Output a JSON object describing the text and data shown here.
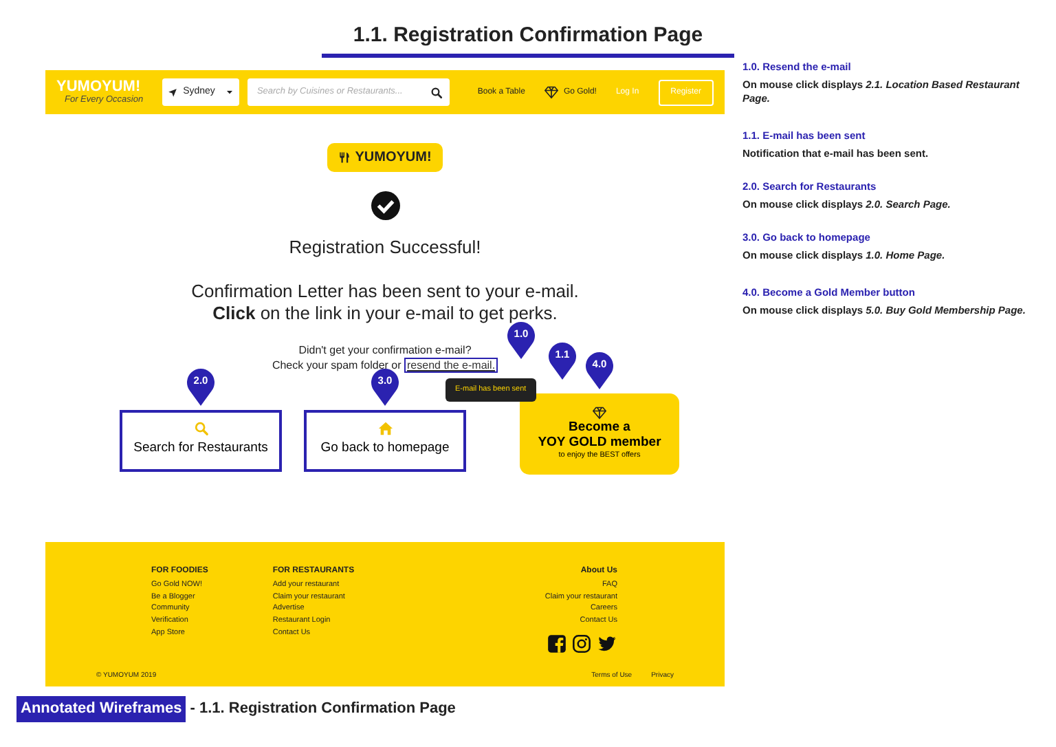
{
  "page_title": "1.1. Registration Confirmation Page",
  "header": {
    "logo": "YUMOYUM!",
    "tagline": "For Every Occasion",
    "location": "Sydney",
    "search_placeholder": "Search by Cuisines or Restaurants...",
    "links": [
      {
        "label": "Book a Table",
        "kind": "plain"
      },
      {
        "label": "Go Gold!",
        "kind": "gold"
      },
      {
        "label": "Log In",
        "kind": "muted"
      },
      {
        "label": "Register",
        "kind": "outline"
      }
    ]
  },
  "content": {
    "badge": "YUMOYUM!",
    "heading": "Registration Successful!",
    "message": "Confirmation Letter has been sent to your e-mail.",
    "message_2": "**Click** on the link in your e-mail to get perks.",
    "prompt": "Didn't get your confirmation e-mail?",
    "prompt_2": "Check your spam folder or",
    "resend_link": "resend the e-mail.",
    "resend_pin": "1.0",
    "tooltip": "E-mail has been sent",
    "tooltip_pin": "1.1",
    "actions": [
      {
        "kind": "search",
        "label": "Search for Restaurants",
        "pin": "2.0"
      },
      {
        "kind": "home",
        "label": "Go back to homepage",
        "pin": "3.0"
      },
      {
        "kind": "gold",
        "label": "Become a",
        "label_2": "YOY GOLD member",
        "note": "to enjoy the BEST offers",
        "pin": "4.0"
      }
    ]
  },
  "footer": {
    "columns": [
      {
        "title": "FOR FOODIES",
        "links": [
          "Go Gold NOW!",
          "Be a Blogger",
          "Community",
          "Verification",
          "App Store"
        ]
      },
      {
        "title": "FOR RESTAURANTS",
        "links": [
          "Add your restaurant",
          "Claim your restaurant",
          "Advertise",
          "Restaurant Login",
          "Contact Us"
        ]
      },
      {
        "title": "About Us",
        "links": [
          "FAQ",
          "Claim your restaurant",
          "Careers",
          "Contact Us"
        ]
      }
    ],
    "copyright": "© YUMOYUM 2019",
    "bottom_links": [
      "Terms of Use",
      "Privacy"
    ]
  },
  "notes": [
    {
      "title": "1.0. Resend the e-mail",
      "text": "On mouse click displays *2.1. Location Based Restaurant Page.*"
    },
    {
      "title": "1.1. E-mail has been sent",
      "text": "Notification that e-mail has been sent."
    },
    {
      "title": "2.0. Search for Restaurants",
      "text": "On mouse click displays *2.0. Search Page.*"
    },
    {
      "title": "3.0. Go back to homepage",
      "text": "On mouse click displays *1.0. Home Page.*"
    },
    {
      "title": "4.0. Become a Gold Member button",
      "text": "On mouse click displays *5.0. Buy Gold Membership Page.*"
    }
  ],
  "caption": {
    "tag": "Annotated Wireframes",
    "text": "- 1.1. Registration Confirmation Page"
  }
}
